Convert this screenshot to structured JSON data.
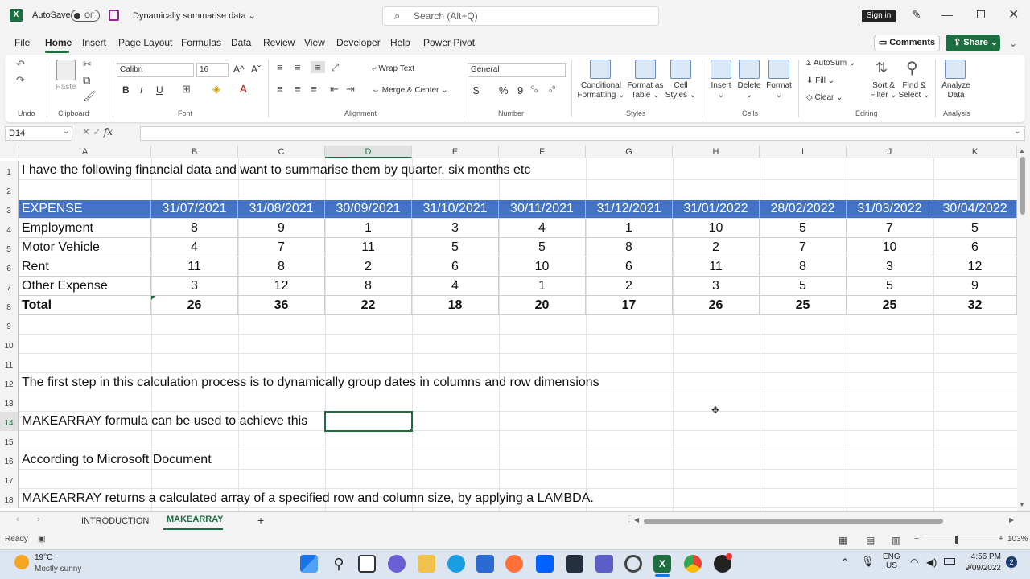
{
  "titlebar": {
    "autosave_label": "AutoSave",
    "autosave_state": "Off",
    "doc_title": "Dynamically summarise data",
    "search_placeholder": "Search (Alt+Q)",
    "signin_label": "Sign in"
  },
  "menu": {
    "items": [
      "File",
      "Home",
      "Insert",
      "Page Layout",
      "Formulas",
      "Data",
      "Review",
      "View",
      "Developer",
      "Help",
      "Power Pivot"
    ],
    "active": "Home",
    "comments_label": "Comments",
    "share_label": "Share"
  },
  "ribbon": {
    "undo_label": "Undo",
    "clipboard": {
      "paste_label": "Paste",
      "group_label": "Clipboard"
    },
    "font": {
      "name": "Calibri",
      "size": "16",
      "group_label": "Font",
      "bold": "B",
      "italic": "I",
      "underline": "U"
    },
    "alignment": {
      "wrap_text": "Wrap Text",
      "merge_center": "Merge & Center",
      "group_label": "Alignment"
    },
    "number": {
      "format": "General",
      "group_label": "Number",
      "currency": "$",
      "percent": "%"
    },
    "styles": {
      "conditional_1": "Conditional",
      "conditional_2": "Formatting",
      "format_table_1": "Format as",
      "format_table_2": "Table",
      "cell_styles_1": "Cell",
      "cell_styles_2": "Styles",
      "group_label": "Styles"
    },
    "cells": {
      "insert": "Insert",
      "delete": "Delete",
      "format": "Format",
      "group_label": "Cells"
    },
    "editing": {
      "autosum": "AutoSum",
      "fill": "Fill",
      "clear": "Clear",
      "sort_1": "Sort &",
      "sort_2": "Filter",
      "find_1": "Find &",
      "find_2": "Select",
      "group_label": "Editing"
    },
    "analysis": {
      "analyze_1": "Analyze",
      "analyze_2": "Data",
      "group_label": "Analysis"
    }
  },
  "formula_bar": {
    "name_box": "D14",
    "fx": "fx",
    "formula": ""
  },
  "grid": {
    "columns": [
      "A",
      "B",
      "C",
      "D",
      "E",
      "F",
      "G",
      "H",
      "I",
      "J",
      "K"
    ],
    "selected_column": "D",
    "rows": [
      "1",
      "2",
      "3",
      "4",
      "5",
      "6",
      "7",
      "8",
      "9",
      "10",
      "11",
      "12",
      "13",
      "14",
      "15",
      "16",
      "17",
      "18"
    ],
    "selected_row": "14",
    "texts": {
      "r1": "I have the following financial data and want to summarise them by quarter, six months etc",
      "r12": "The first step in this calculation process is to dynamically group dates in columns and row dimensions",
      "r14": "MAKEARRAY formula can be used to achieve this",
      "r16": "According to Microsoft Document",
      "r18": "MAKEARRAY returns a calculated array of a specified row and column size, by applying a LAMBDA."
    },
    "table": {
      "header": [
        "EXPENSE CATEGORY",
        "31/07/2021",
        "31/08/2021",
        "30/09/2021",
        "31/10/2021",
        "30/11/2021",
        "31/12/2021",
        "31/01/2022",
        "28/02/2022",
        "31/03/2022",
        "30/04/2022"
      ],
      "rows": [
        [
          "Employment",
          "8",
          "9",
          "1",
          "3",
          "4",
          "1",
          "10",
          "5",
          "7",
          "5"
        ],
        [
          "Motor Vehicle",
          "4",
          "7",
          "11",
          "5",
          "5",
          "8",
          "2",
          "7",
          "10",
          "6"
        ],
        [
          "Rent",
          "11",
          "8",
          "2",
          "6",
          "10",
          "6",
          "11",
          "8",
          "3",
          "12"
        ],
        [
          "Other Expense",
          "3",
          "12",
          "8",
          "4",
          "1",
          "2",
          "3",
          "5",
          "5",
          "9"
        ],
        [
          "Total",
          "26",
          "36",
          "22",
          "18",
          "20",
          "17",
          "26",
          "25",
          "25",
          "32"
        ]
      ]
    }
  },
  "sheets": {
    "tabs": [
      "INTRODUCTION",
      "MAKEARRAY"
    ],
    "active": "MAKEARRAY",
    "add": "+"
  },
  "status": {
    "ready": "Ready",
    "zoom": "103%"
  },
  "taskbar": {
    "weather_temp": "19°C",
    "weather_desc": "Mostly sunny",
    "lang_1": "ENG",
    "lang_2": "US",
    "time": "4:56 PM",
    "date": "9/09/2022",
    "notif_count": "2"
  },
  "colors": {
    "accent": "#1d6f42",
    "table_header": "#4472c4"
  }
}
